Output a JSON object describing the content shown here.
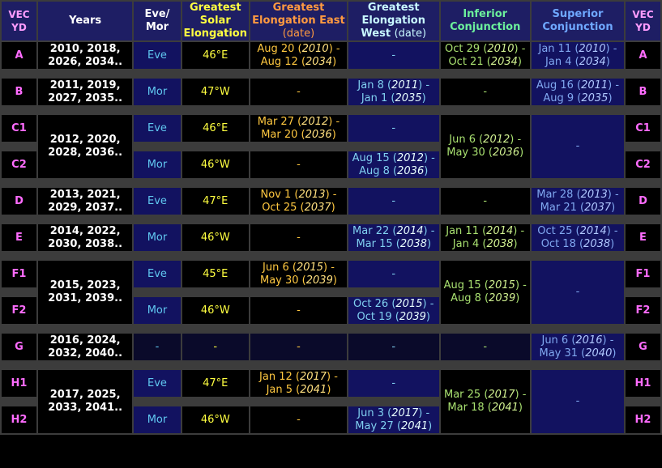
{
  "headers": {
    "vec_yd": "VEC YD",
    "years": "Years",
    "eve_mor": "Eve/ Mor",
    "solar": "Greatest Solar Elongation",
    "east": "Greatest Elongation East",
    "west": "Greatest Elongation West",
    "date_suffix": "(date)",
    "inferior": "Inferior Conjunction",
    "superior": "Superior Conjunction"
  },
  "rows": [
    {
      "vec": "A",
      "years": "2010, 2018, 2026, 2034..",
      "evemor": "Eve",
      "solar": "46°E",
      "east": {
        "d1": "Aug 20",
        "y1": "2010",
        "d2": "Aug 12",
        "y2": "2034"
      },
      "west": null,
      "inf": {
        "d1": "Oct 29",
        "y1": "2010",
        "d2": "Oct 21",
        "y2": "2034"
      },
      "sup": {
        "d1": "Jan 11",
        "y1": "2010",
        "d2": "Jan 4",
        "y2": "2034"
      }
    },
    {
      "vec": "B",
      "years": "2011, 2019, 2027, 2035..",
      "evemor": "Mor",
      "solar": "47°W",
      "east": null,
      "west": {
        "d1": "Jan 8",
        "y1": "2011",
        "d2": "Jan 1",
        "y2": "2035"
      },
      "inf": null,
      "sup": {
        "d1": "Aug 16",
        "y1": "2011",
        "d2": "Aug 9",
        "y2": "2035"
      }
    },
    {
      "vec": "C1",
      "years": "2012, 2020, 2028, 2036..",
      "evemor": "Eve",
      "solar": "46°E",
      "east": {
        "d1": "Mar 27",
        "y1": "2012",
        "d2": "Mar 20",
        "y2": "2036"
      },
      "west": null,
      "inf": {
        "d1": "Jun 6",
        "y1": "2012",
        "d2": "May 30",
        "y2": "2036"
      },
      "sup": null
    },
    {
      "vec": "C2",
      "evemor": "Mor",
      "solar": "46°W",
      "east": null,
      "west": {
        "d1": "Aug 15",
        "y1": "2012",
        "d2": "Aug 8",
        "y2": "2036"
      }
    },
    {
      "vec": "D",
      "years": "2013, 2021, 2029, 2037..",
      "evemor": "Eve",
      "solar": "47°E",
      "east": {
        "d1": "Nov 1",
        "y1": "2013",
        "d2": "Oct 25",
        "y2": "2037"
      },
      "west": null,
      "inf": null,
      "sup": {
        "d1": "Mar 28",
        "y1": "2013",
        "d2": "Mar 21",
        "y2": "2037"
      }
    },
    {
      "vec": "E",
      "years": "2014, 2022, 2030, 2038..",
      "evemor": "Mor",
      "solar": "46°W",
      "east": null,
      "west": {
        "d1": "Mar 22",
        "y1": "2014",
        "d2": "Mar 15",
        "y2": "2038"
      },
      "inf": {
        "d1": "Jan 11",
        "y1": "2014",
        "d2": "Jan 4",
        "y2": "2038"
      },
      "sup": {
        "d1": "Oct 25",
        "y1": "2014",
        "d2": "Oct 18",
        "y2": "2038"
      }
    },
    {
      "vec": "F1",
      "years": "2015, 2023, 2031, 2039..",
      "evemor": "Eve",
      "solar": "45°E",
      "east": {
        "d1": "Jun 6",
        "y1": "2015",
        "d2": "May 30",
        "y2": "2039"
      },
      "west": null,
      "inf": {
        "d1": "Aug 15",
        "y1": "2015",
        "d2": "Aug 8",
        "y2": "2039"
      },
      "sup": null
    },
    {
      "vec": "F2",
      "evemor": "Mor",
      "solar": "46°W",
      "east": null,
      "west": {
        "d1": "Oct 26",
        "y1": "2015",
        "d2": "Oct 19",
        "y2": "2039"
      }
    },
    {
      "vec": "G",
      "years": "2016, 2024, 2032, 2040..",
      "evemor": "-",
      "solar": "-",
      "east": null,
      "west": null,
      "inf": null,
      "sup": {
        "d1": "Jun 6",
        "y1": "2016",
        "d2": "May 31",
        "y2": "2040"
      }
    },
    {
      "vec": "H1",
      "years": "2017, 2025, 2033, 2041..",
      "evemor": "Eve",
      "solar": "47°E",
      "east": {
        "d1": "Jan 12",
        "y1": "2017",
        "d2": "Jan 5",
        "y2": "2041"
      },
      "west": null,
      "inf": {
        "d1": "Mar 25",
        "y1": "2017",
        "d2": "Mar 18",
        "y2": "2041"
      },
      "sup": null
    },
    {
      "vec": "H2",
      "evemor": "Mor",
      "solar": "46°W",
      "east": null,
      "west": {
        "d1": "Jun 3",
        "y1": "2017",
        "d2": "May 27",
        "y2": "2041"
      }
    }
  ],
  "dash": "-"
}
